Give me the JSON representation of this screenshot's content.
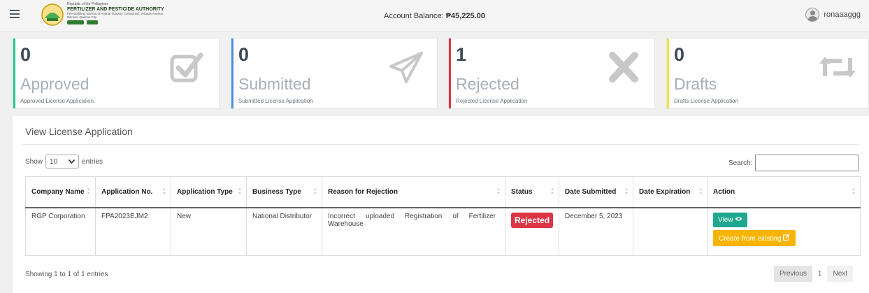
{
  "header": {
    "org_republic": "Republic of the Philippines",
    "org_name": "FERTILIZER AND PESTICIDE AUTHORITY",
    "org_address": "FPA Building, Bureau of Animal Industry Compound, Visayas Avenue, Diliman, Quezon City",
    "balance_label": "Account Balance: ",
    "balance_value": "₱45,225.00",
    "username": "ronaaaggg"
  },
  "cards": [
    {
      "count": "0",
      "label": "Approved",
      "sub": "Approved License Application.",
      "color": "#20c997",
      "icon": "checkbox-icon"
    },
    {
      "count": "0",
      "label": "Submitted",
      "sub": "Submitted License Application",
      "color": "#4a90e2",
      "icon": "paper-plane-icon"
    },
    {
      "count": "1",
      "label": "Rejected",
      "sub": "Rejected License Application",
      "color": "#dc3545",
      "icon": "close-icon"
    },
    {
      "count": "0",
      "label": "Drafts",
      "sub": "Drafts License Application",
      "color": "#f5e63c",
      "icon": "retweet-icon"
    }
  ],
  "panel": {
    "title": "View License Application",
    "show_label": "Show",
    "entries_value": "10",
    "entries_label": "entries",
    "search_label": "Search:",
    "info": "Showing 1 to 1 of 1 entries",
    "pagination": {
      "previous": "Previous",
      "page": "1",
      "next": "Next"
    }
  },
  "table": {
    "columns": [
      "Company Name",
      "Application No.",
      "Application Type",
      "Business Type",
      "Reason for Rejection",
      "Status",
      "Date Submitted",
      "Date Expiration",
      "Action"
    ],
    "rows": [
      {
        "company": "RGP Corporation",
        "app_no": "FPA2023EJM2",
        "app_type": "New",
        "business_type": "National Distributor",
        "reason": "Incorrect uploaded Registration of Fertilizer Warehouse",
        "status": "Rejected",
        "date_submitted": "December 5, 2023",
        "date_expiration": "",
        "actions": {
          "view": "View",
          "create": "Create from existing"
        }
      }
    ]
  },
  "colors": {
    "accent_teal": "#1fa78f",
    "warning": "#f8b400",
    "danger": "#dc3545"
  }
}
